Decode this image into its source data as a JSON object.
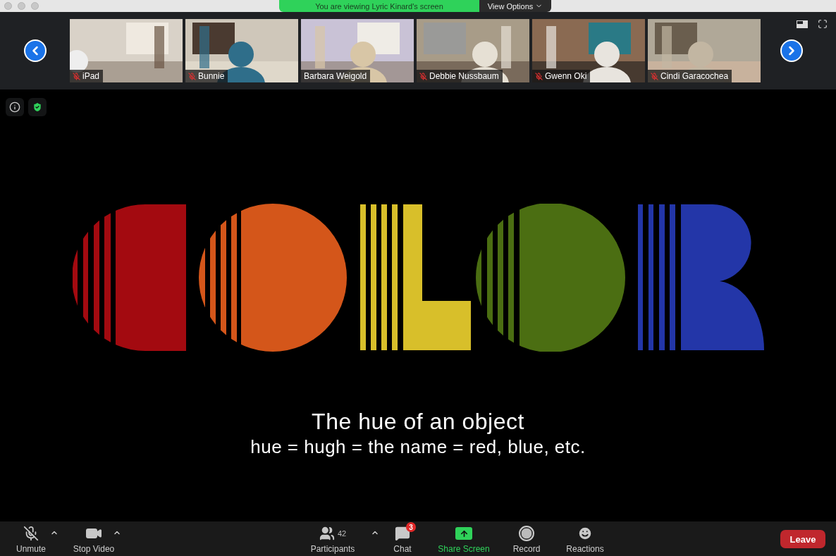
{
  "top_bar": {
    "banner": "You are viewing Lyric Kinard's screen",
    "view_options": "View Options"
  },
  "gallery": {
    "participants": [
      {
        "name": "iPad",
        "muted": true
      },
      {
        "name": "Bunnie",
        "muted": true
      },
      {
        "name": "Barbara Weigold",
        "muted": false
      },
      {
        "name": "Debbie Nussbaum",
        "muted": true
      },
      {
        "name": "Gwenn Oki",
        "muted": true
      },
      {
        "name": "Cindi Garacochea",
        "muted": true
      }
    ]
  },
  "slide": {
    "lines": [
      "The hue of an object",
      "hue = hugh = the name = red, blue, etc."
    ]
  },
  "toolbar": {
    "items": [
      {
        "kind": "mic",
        "label": "Unmute",
        "muted": true
      },
      {
        "kind": "video",
        "label": "Stop Video"
      },
      {
        "kind": "participants",
        "label": "Participants",
        "count": "42"
      },
      {
        "kind": "chat",
        "label": "Chat",
        "badge": "3"
      },
      {
        "kind": "share",
        "label": "Share Screen"
      },
      {
        "kind": "record",
        "label": "Record"
      },
      {
        "kind": "reactions",
        "label": "Reactions"
      }
    ],
    "leave": "Leave"
  }
}
